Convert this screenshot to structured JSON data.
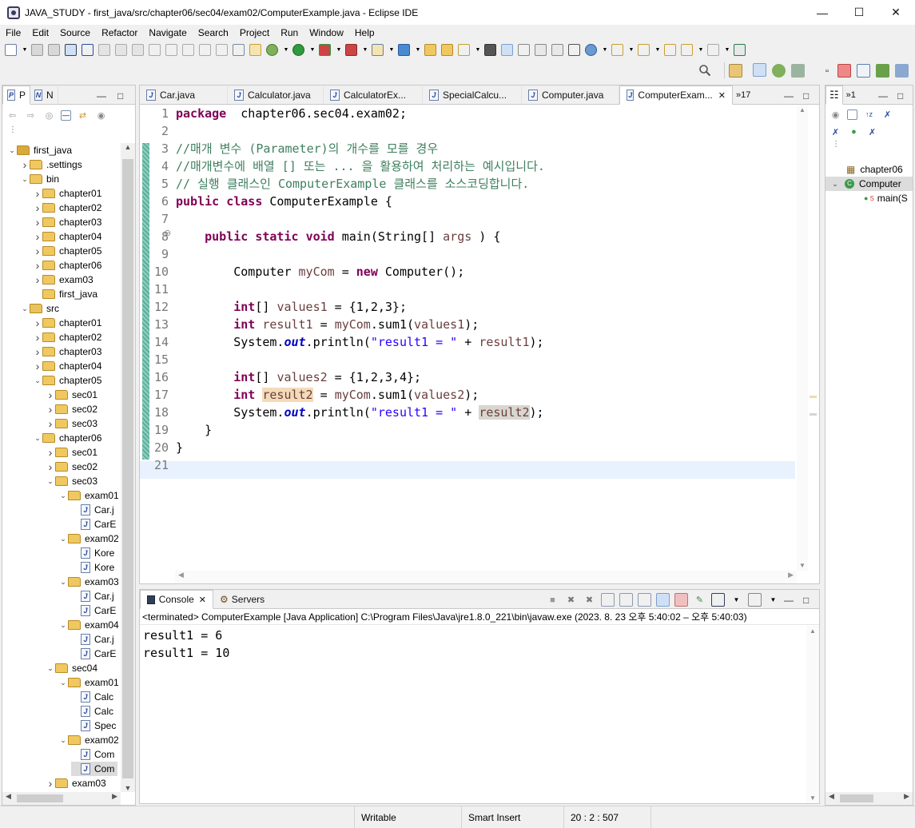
{
  "window": {
    "title": "JAVA_STUDY - first_java/src/chapter06/sec04/exam02/ComputerExample.java - Eclipse IDE"
  },
  "menu": [
    "File",
    "Edit",
    "Source",
    "Refactor",
    "Navigate",
    "Search",
    "Project",
    "Run",
    "Window",
    "Help"
  ],
  "explorer": {
    "tabs": [
      "P",
      "N"
    ],
    "items": [
      {
        "label": "first_java",
        "depth": 0,
        "expanded": true,
        "kind": "proj"
      },
      {
        "label": ".settings",
        "depth": 1,
        "expanded": false,
        "kind": "folder"
      },
      {
        "label": "bin",
        "depth": 1,
        "expanded": true,
        "kind": "folder"
      },
      {
        "label": "chapter01",
        "depth": 2,
        "expanded": false,
        "kind": "folder"
      },
      {
        "label": "chapter02",
        "depth": 2,
        "expanded": false,
        "kind": "folder"
      },
      {
        "label": "chapter03",
        "depth": 2,
        "expanded": false,
        "kind": "folder"
      },
      {
        "label": "chapter04",
        "depth": 2,
        "expanded": false,
        "kind": "folder"
      },
      {
        "label": "chapter05",
        "depth": 2,
        "expanded": false,
        "kind": "folder"
      },
      {
        "label": "chapter06",
        "depth": 2,
        "expanded": false,
        "kind": "folder"
      },
      {
        "label": "exam03",
        "depth": 2,
        "expanded": false,
        "kind": "folder"
      },
      {
        "label": "first_java",
        "depth": 2,
        "expanded": null,
        "kind": "folder"
      },
      {
        "label": "src",
        "depth": 1,
        "expanded": true,
        "kind": "src"
      },
      {
        "label": "chapter01",
        "depth": 2,
        "expanded": false,
        "kind": "folder"
      },
      {
        "label": "chapter02",
        "depth": 2,
        "expanded": false,
        "kind": "folder"
      },
      {
        "label": "chapter03",
        "depth": 2,
        "expanded": false,
        "kind": "folder"
      },
      {
        "label": "chapter04",
        "depth": 2,
        "expanded": false,
        "kind": "folder"
      },
      {
        "label": "chapter05",
        "depth": 2,
        "expanded": true,
        "kind": "folder"
      },
      {
        "label": "sec01",
        "depth": 3,
        "expanded": false,
        "kind": "folder"
      },
      {
        "label": "sec02",
        "depth": 3,
        "expanded": false,
        "kind": "folder"
      },
      {
        "label": "sec03",
        "depth": 3,
        "expanded": false,
        "kind": "folder"
      },
      {
        "label": "chapter06",
        "depth": 2,
        "expanded": true,
        "kind": "folder"
      },
      {
        "label": "sec01",
        "depth": 3,
        "expanded": false,
        "kind": "folder"
      },
      {
        "label": "sec02",
        "depth": 3,
        "expanded": false,
        "kind": "folder"
      },
      {
        "label": "sec03",
        "depth": 3,
        "expanded": true,
        "kind": "folder"
      },
      {
        "label": "exam01",
        "depth": 4,
        "expanded": true,
        "kind": "folder"
      },
      {
        "label": "Car.j",
        "depth": 5,
        "expanded": null,
        "kind": "java"
      },
      {
        "label": "CarE",
        "depth": 5,
        "expanded": null,
        "kind": "java"
      },
      {
        "label": "exam02",
        "depth": 4,
        "expanded": true,
        "kind": "folder"
      },
      {
        "label": "Kore",
        "depth": 5,
        "expanded": null,
        "kind": "java"
      },
      {
        "label": "Kore",
        "depth": 5,
        "expanded": null,
        "kind": "java"
      },
      {
        "label": "exam03",
        "depth": 4,
        "expanded": true,
        "kind": "folder"
      },
      {
        "label": "Car.j",
        "depth": 5,
        "expanded": null,
        "kind": "java"
      },
      {
        "label": "CarE",
        "depth": 5,
        "expanded": null,
        "kind": "java"
      },
      {
        "label": "exam04",
        "depth": 4,
        "expanded": true,
        "kind": "folder"
      },
      {
        "label": "Car.j",
        "depth": 5,
        "expanded": null,
        "kind": "java"
      },
      {
        "label": "CarE",
        "depth": 5,
        "expanded": null,
        "kind": "java"
      },
      {
        "label": "sec04",
        "depth": 3,
        "expanded": true,
        "kind": "folder"
      },
      {
        "label": "exam01",
        "depth": 4,
        "expanded": true,
        "kind": "folder"
      },
      {
        "label": "Calc",
        "depth": 5,
        "expanded": null,
        "kind": "java"
      },
      {
        "label": "Calc",
        "depth": 5,
        "expanded": null,
        "kind": "java"
      },
      {
        "label": "Spec",
        "depth": 5,
        "expanded": null,
        "kind": "java"
      },
      {
        "label": "exam02",
        "depth": 4,
        "expanded": true,
        "kind": "folder"
      },
      {
        "label": "Com",
        "depth": 5,
        "expanded": null,
        "kind": "java"
      },
      {
        "label": "Com",
        "depth": 5,
        "expanded": null,
        "kind": "java",
        "selected": true
      },
      {
        "label": "exam03",
        "depth": 3,
        "expanded": false,
        "kind": "folder"
      }
    ]
  },
  "editor": {
    "tabs": [
      "Car.java",
      "Calculator.java",
      "CalculatorEx...",
      "SpecialCalcu...",
      "Computer.java",
      "ComputerExam..."
    ],
    "overflow": "»17",
    "active_tab": 5,
    "line_numbers": [
      "1",
      "2",
      "3",
      "4",
      "5",
      "6",
      "7",
      "8",
      "9",
      "10",
      "11",
      "12",
      "13",
      "14",
      "15",
      "16",
      "17",
      "18",
      "19",
      "20",
      "21"
    ],
    "lines": [
      {
        "n": 1,
        "tokens": [
          [
            "kw",
            "package"
          ],
          [
            "",
            "  chapter06.sec04.exam02;"
          ]
        ]
      },
      {
        "n": 2,
        "tokens": []
      },
      {
        "n": 3,
        "tokens": [
          [
            "cm",
            "//매개 변수 (Parameter)의 개수를 모를 경우"
          ]
        ]
      },
      {
        "n": 4,
        "tokens": [
          [
            "cm",
            "//매개변수에 배열 [] 또는 ... 을 활용하여 처리하는 예시입니다."
          ]
        ]
      },
      {
        "n": 5,
        "tokens": [
          [
            "cm",
            "// 실행 클래스인 ComputerExample 클래스를 소스코딩합니다."
          ]
        ]
      },
      {
        "n": 6,
        "tokens": [
          [
            "kw",
            "public"
          ],
          [
            "",
            " "
          ],
          [
            "kw",
            "class"
          ],
          [
            "",
            " ComputerExample {"
          ]
        ]
      },
      {
        "n": 7,
        "tokens": []
      },
      {
        "n": 8,
        "tokens": [
          [
            "",
            "    "
          ],
          [
            "kw",
            "public"
          ],
          [
            "",
            " "
          ],
          [
            "kw",
            "static"
          ],
          [
            "",
            " "
          ],
          [
            "kw",
            "void"
          ],
          [
            "",
            " main(String[] "
          ],
          [
            "lv",
            "args"
          ],
          [
            "",
            " ) {"
          ]
        ]
      },
      {
        "n": 9,
        "tokens": []
      },
      {
        "n": 10,
        "tokens": [
          [
            "",
            "        Computer "
          ],
          [
            "lv",
            "myCom"
          ],
          [
            "",
            " = "
          ],
          [
            "kw",
            "new"
          ],
          [
            "",
            " Computer();"
          ]
        ]
      },
      {
        "n": 11,
        "tokens": []
      },
      {
        "n": 12,
        "tokens": [
          [
            "",
            "        "
          ],
          [
            "kw",
            "int"
          ],
          [
            "",
            "[] "
          ],
          [
            "lv",
            "values1"
          ],
          [
            "",
            " = {1,2,3};"
          ]
        ]
      },
      {
        "n": 13,
        "tokens": [
          [
            "",
            "        "
          ],
          [
            "kw",
            "int"
          ],
          [
            "",
            " "
          ],
          [
            "lv",
            "result1"
          ],
          [
            "",
            " = "
          ],
          [
            "lv",
            "myCom"
          ],
          [
            "",
            ".sum1("
          ],
          [
            "lv",
            "values1"
          ],
          [
            "",
            ");"
          ]
        ]
      },
      {
        "n": 14,
        "tokens": [
          [
            "",
            "        System."
          ],
          [
            "fld",
            "out"
          ],
          [
            "",
            ".println("
          ],
          [
            "st",
            "\"result1 = \""
          ],
          [
            "",
            " + "
          ],
          [
            "lv",
            "result1"
          ],
          [
            "",
            ");"
          ]
        ]
      },
      {
        "n": 15,
        "tokens": []
      },
      {
        "n": 16,
        "tokens": [
          [
            "",
            "        "
          ],
          [
            "kw",
            "int"
          ],
          [
            "",
            "[] "
          ],
          [
            "lv",
            "values2"
          ],
          [
            "",
            " = {1,2,3,4};"
          ]
        ]
      },
      {
        "n": 17,
        "tokens": [
          [
            "",
            "        "
          ],
          [
            "kw",
            "int"
          ],
          [
            "",
            " "
          ],
          [
            "lv occ-w",
            "result2"
          ],
          [
            "",
            " = "
          ],
          [
            "lv",
            "myCom"
          ],
          [
            "",
            ".sum1("
          ],
          [
            "lv",
            "values2"
          ],
          [
            "",
            ");"
          ]
        ]
      },
      {
        "n": 18,
        "tokens": [
          [
            "",
            "        System."
          ],
          [
            "fld",
            "out"
          ],
          [
            "",
            ".println("
          ],
          [
            "st",
            "\"result1 = \""
          ],
          [
            "",
            " + "
          ],
          [
            "lv occ-r",
            "result2"
          ],
          [
            "",
            ");"
          ]
        ]
      },
      {
        "n": 19,
        "tokens": [
          [
            "",
            "    }"
          ]
        ]
      },
      {
        "n": 20,
        "tokens": [
          [
            "",
            "}"
          ]
        ]
      },
      {
        "n": 21,
        "tokens": []
      }
    ]
  },
  "console": {
    "tabs": [
      "Console",
      "Servers"
    ],
    "header": "<terminated> ComputerExample [Java Application] C:\\Program Files\\Java\\jre1.8.0_221\\bin\\javaw.exe  (2023. 8. 23 오후 5:40:02 – 오후 5:40:03)",
    "output": [
      "result1 = 6",
      "result1 = 10"
    ]
  },
  "outline": {
    "tabs": [
      "»1"
    ],
    "items": [
      {
        "label": "chapter06",
        "depth": 0
      },
      {
        "label": "Computer",
        "depth": 0,
        "expanded": true
      },
      {
        "label": "main(S",
        "depth": 1
      }
    ]
  },
  "status": {
    "writable": "Writable",
    "insert": "Smart Insert",
    "position": "20 : 2 : 507"
  },
  "colors": {
    "keyword": "#7f0055",
    "comment": "#3f7f5f",
    "string": "#2a00ff",
    "field": "#0000c0",
    "local": "#6a3e3e",
    "current_line": "#e8f2fe",
    "change_bar": "#5fae9b"
  }
}
